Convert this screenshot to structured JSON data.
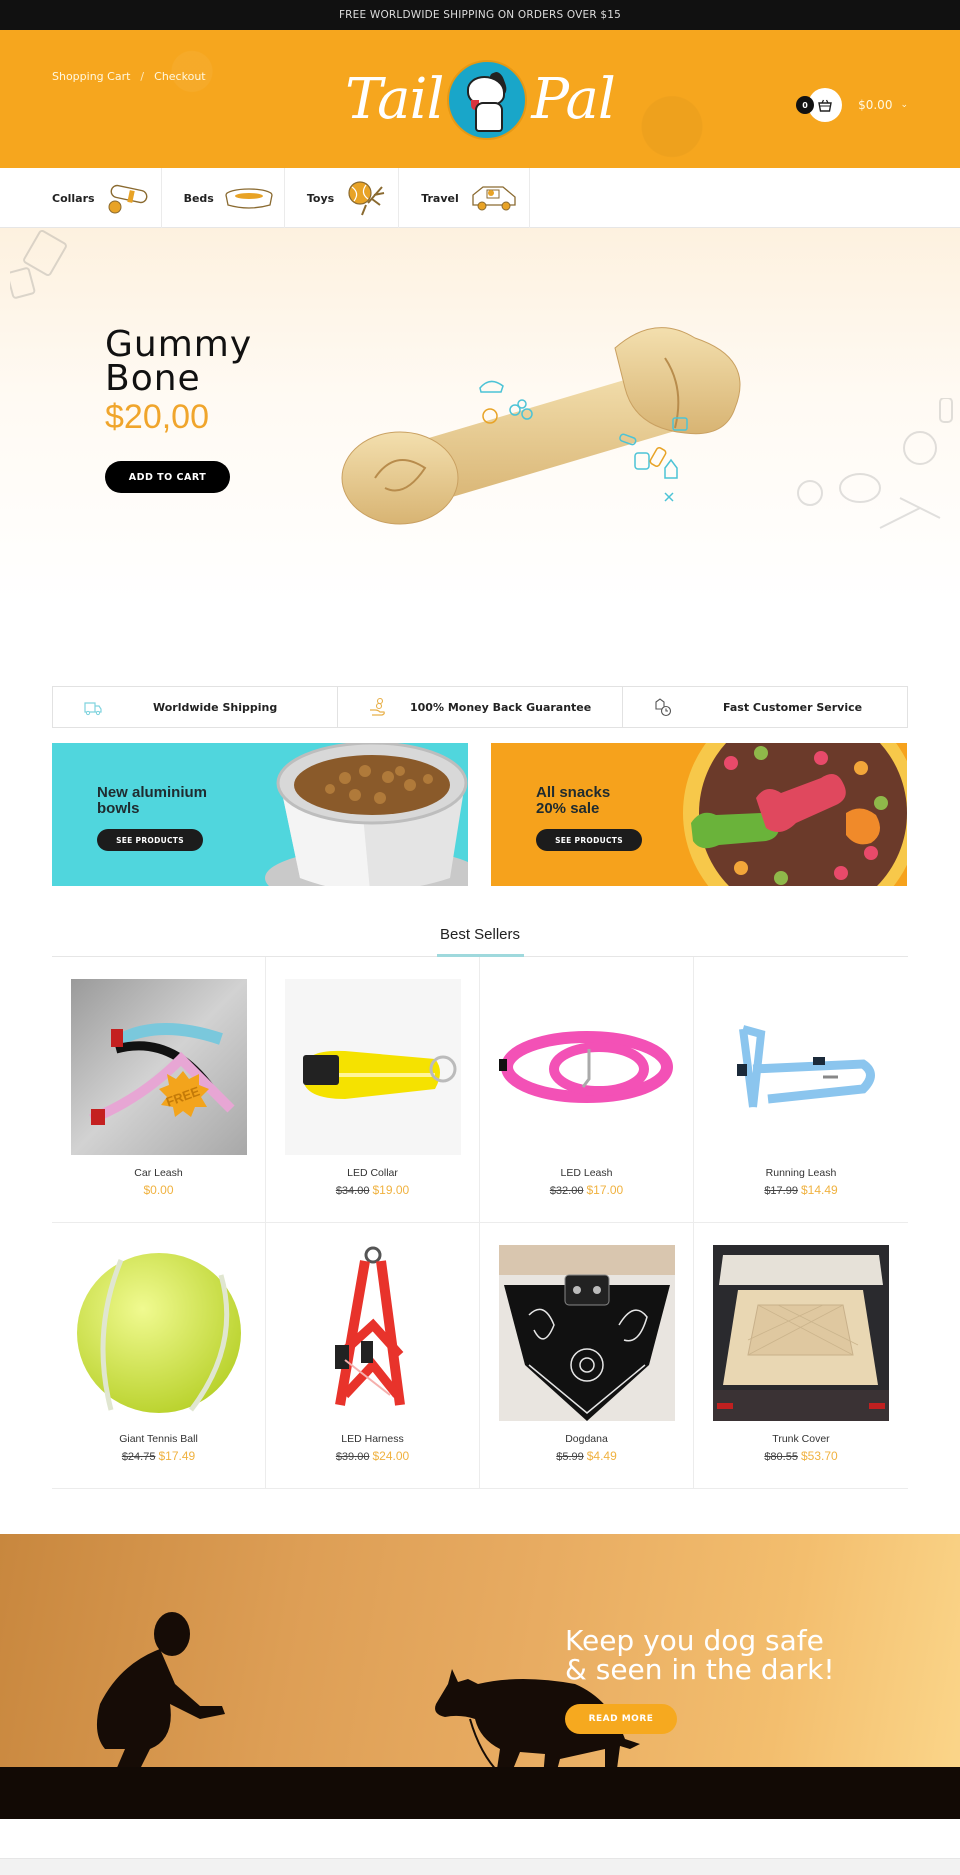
{
  "topbar": {
    "text": "FREE WORLDWIDE SHIPPING ON ORDERS OVER $15"
  },
  "header": {
    "links": [
      {
        "label": "Shopping Cart"
      },
      {
        "label": "Checkout"
      }
    ],
    "separator": "/",
    "logo": {
      "left_word": "Tail",
      "right_word": "Pal",
      "icon": "dog-logo-icon"
    },
    "cart": {
      "count": "0",
      "total": "$0.00",
      "icon": "basket-icon"
    }
  },
  "categories": [
    {
      "label": "Collars",
      "icon": "collar-icon"
    },
    {
      "label": "Beds",
      "icon": "bed-icon"
    },
    {
      "label": "Toys",
      "icon": "ball-toy-icon"
    },
    {
      "label": "Travel",
      "icon": "car-icon"
    }
  ],
  "hero": {
    "title_line1": "Gummy",
    "title_line2": "Bone",
    "price": "$20,00",
    "button": "ADD TO CART"
  },
  "features": [
    {
      "label": "Worldwide Shipping",
      "icon": "truck-icon"
    },
    {
      "label": "100% Money Back Guarantee",
      "icon": "money-hand-icon"
    },
    {
      "label": "Fast Customer Service",
      "icon": "clock-box-icon"
    }
  ],
  "promos": [
    {
      "line1": "New aluminium",
      "line2": "bowls",
      "button": "SEE PRODUCTS"
    },
    {
      "line1": "All snacks",
      "line2": "20% sale",
      "button": "SEE PRODUCTS"
    }
  ],
  "best_sellers": {
    "title": "Best Sellers",
    "products": [
      {
        "name": "Car Leash",
        "old_price": "",
        "price": "$0.00",
        "badge": "FREE"
      },
      {
        "name": "LED Collar",
        "old_price": "$34.00",
        "price": "$19.00"
      },
      {
        "name": "LED Leash",
        "old_price": "$32.00",
        "price": "$17.00"
      },
      {
        "name": "Running Leash",
        "old_price": "$17.99",
        "price": "$14.49"
      },
      {
        "name": "Giant Tennis Ball",
        "old_price": "$24.75",
        "price": "$17.49"
      },
      {
        "name": "LED Harness",
        "old_price": "$39.00",
        "price": "$24.00"
      },
      {
        "name": "Dogdana",
        "old_price": "$5.99",
        "price": "$4.49"
      },
      {
        "name": "Trunk Cover",
        "old_price": "$80.55",
        "price": "$53.70"
      }
    ]
  },
  "banner": {
    "line1": "Keep you dog safe",
    "line2": "& seen in the dark!",
    "button": "READ MORE"
  },
  "colors": {
    "brand_orange": "#f6a61e",
    "price_gold": "#f0b240",
    "accent_teal": "#9fd9dd",
    "promo_cyan": "#50d6dd"
  }
}
